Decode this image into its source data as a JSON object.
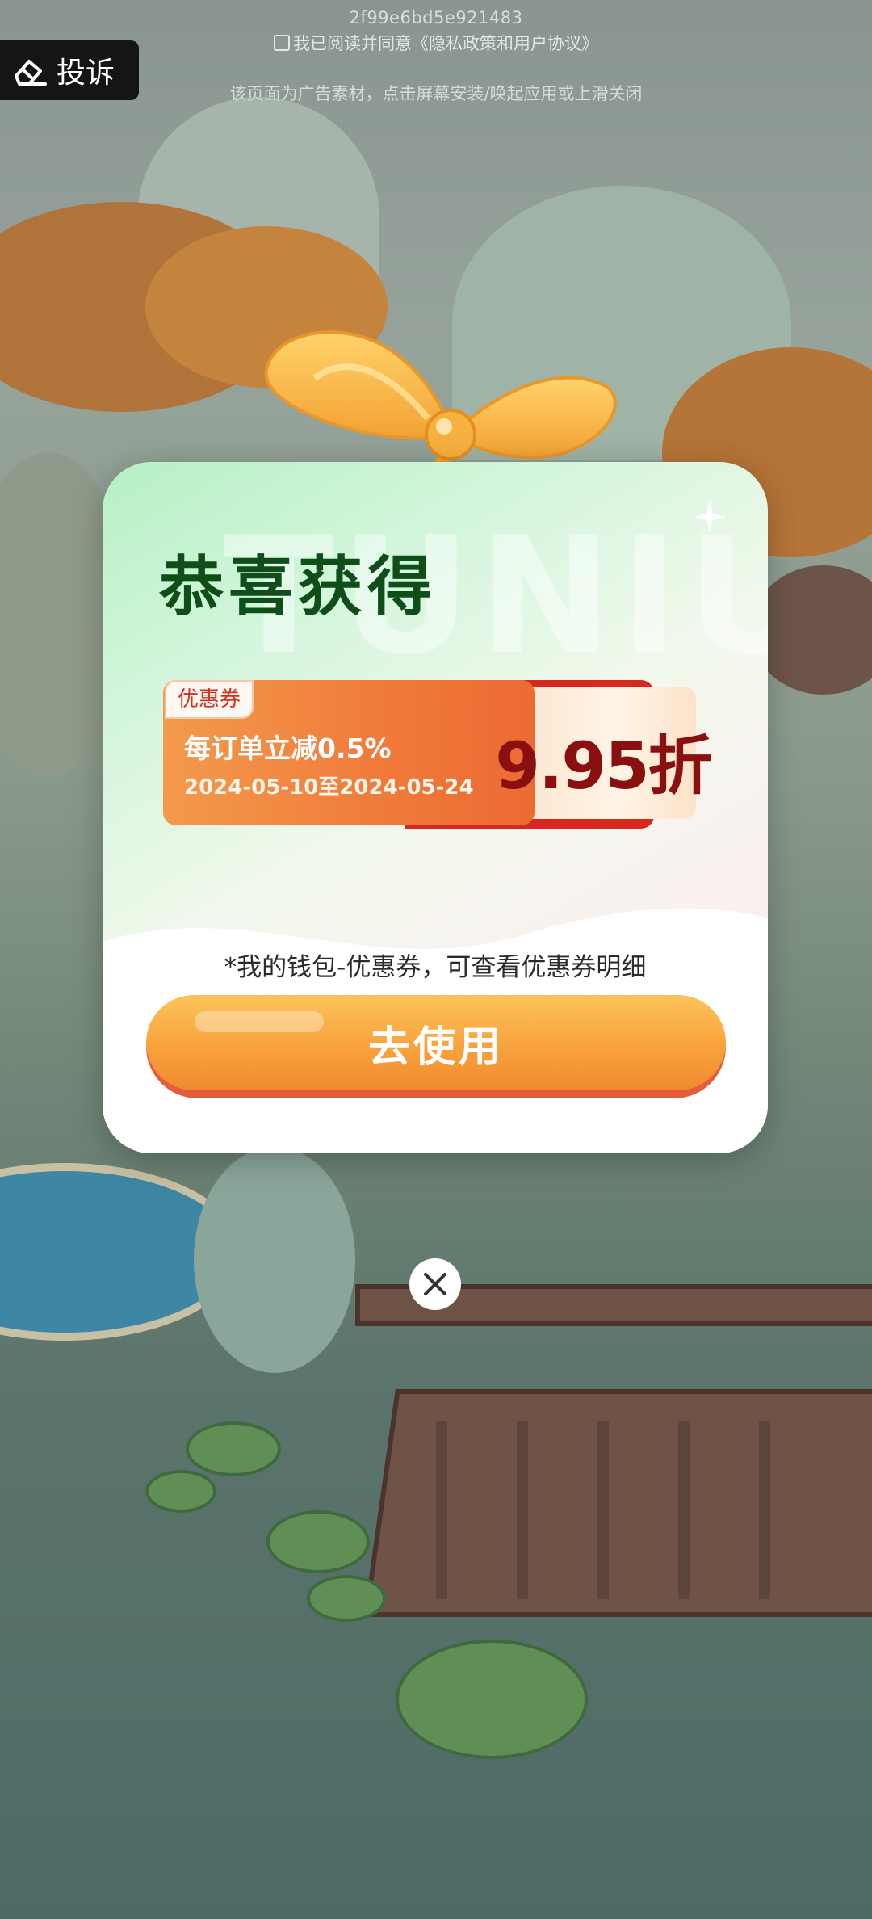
{
  "top_bar": {
    "ad_id": "2f99e6bd5e921483",
    "agreement": "我已阅读并同意《隐私政策和用户协议》",
    "notice": "该页面为广告素材，点击屏幕安装/唤起应用或上滑关闭",
    "complain_label": "投诉",
    "complain_icon": "eraser-icon"
  },
  "popup": {
    "title": "恭喜获得",
    "watermark": "TUNIU",
    "coupon": {
      "tag": "优惠券",
      "description": "每订单立减0.5%",
      "dates": "2024-05-10至2024-05-24",
      "discount": "9.95折"
    },
    "hint": "*我的钱包-优惠券，可查看优惠券明细",
    "use_button": "去使用"
  },
  "close_icon": "close-icon",
  "colors": {
    "title_green": "#0f4d19",
    "button_orange": "#f8a23d",
    "coupon_orange": "#f07a3a",
    "discount_red": "#8a1010"
  }
}
